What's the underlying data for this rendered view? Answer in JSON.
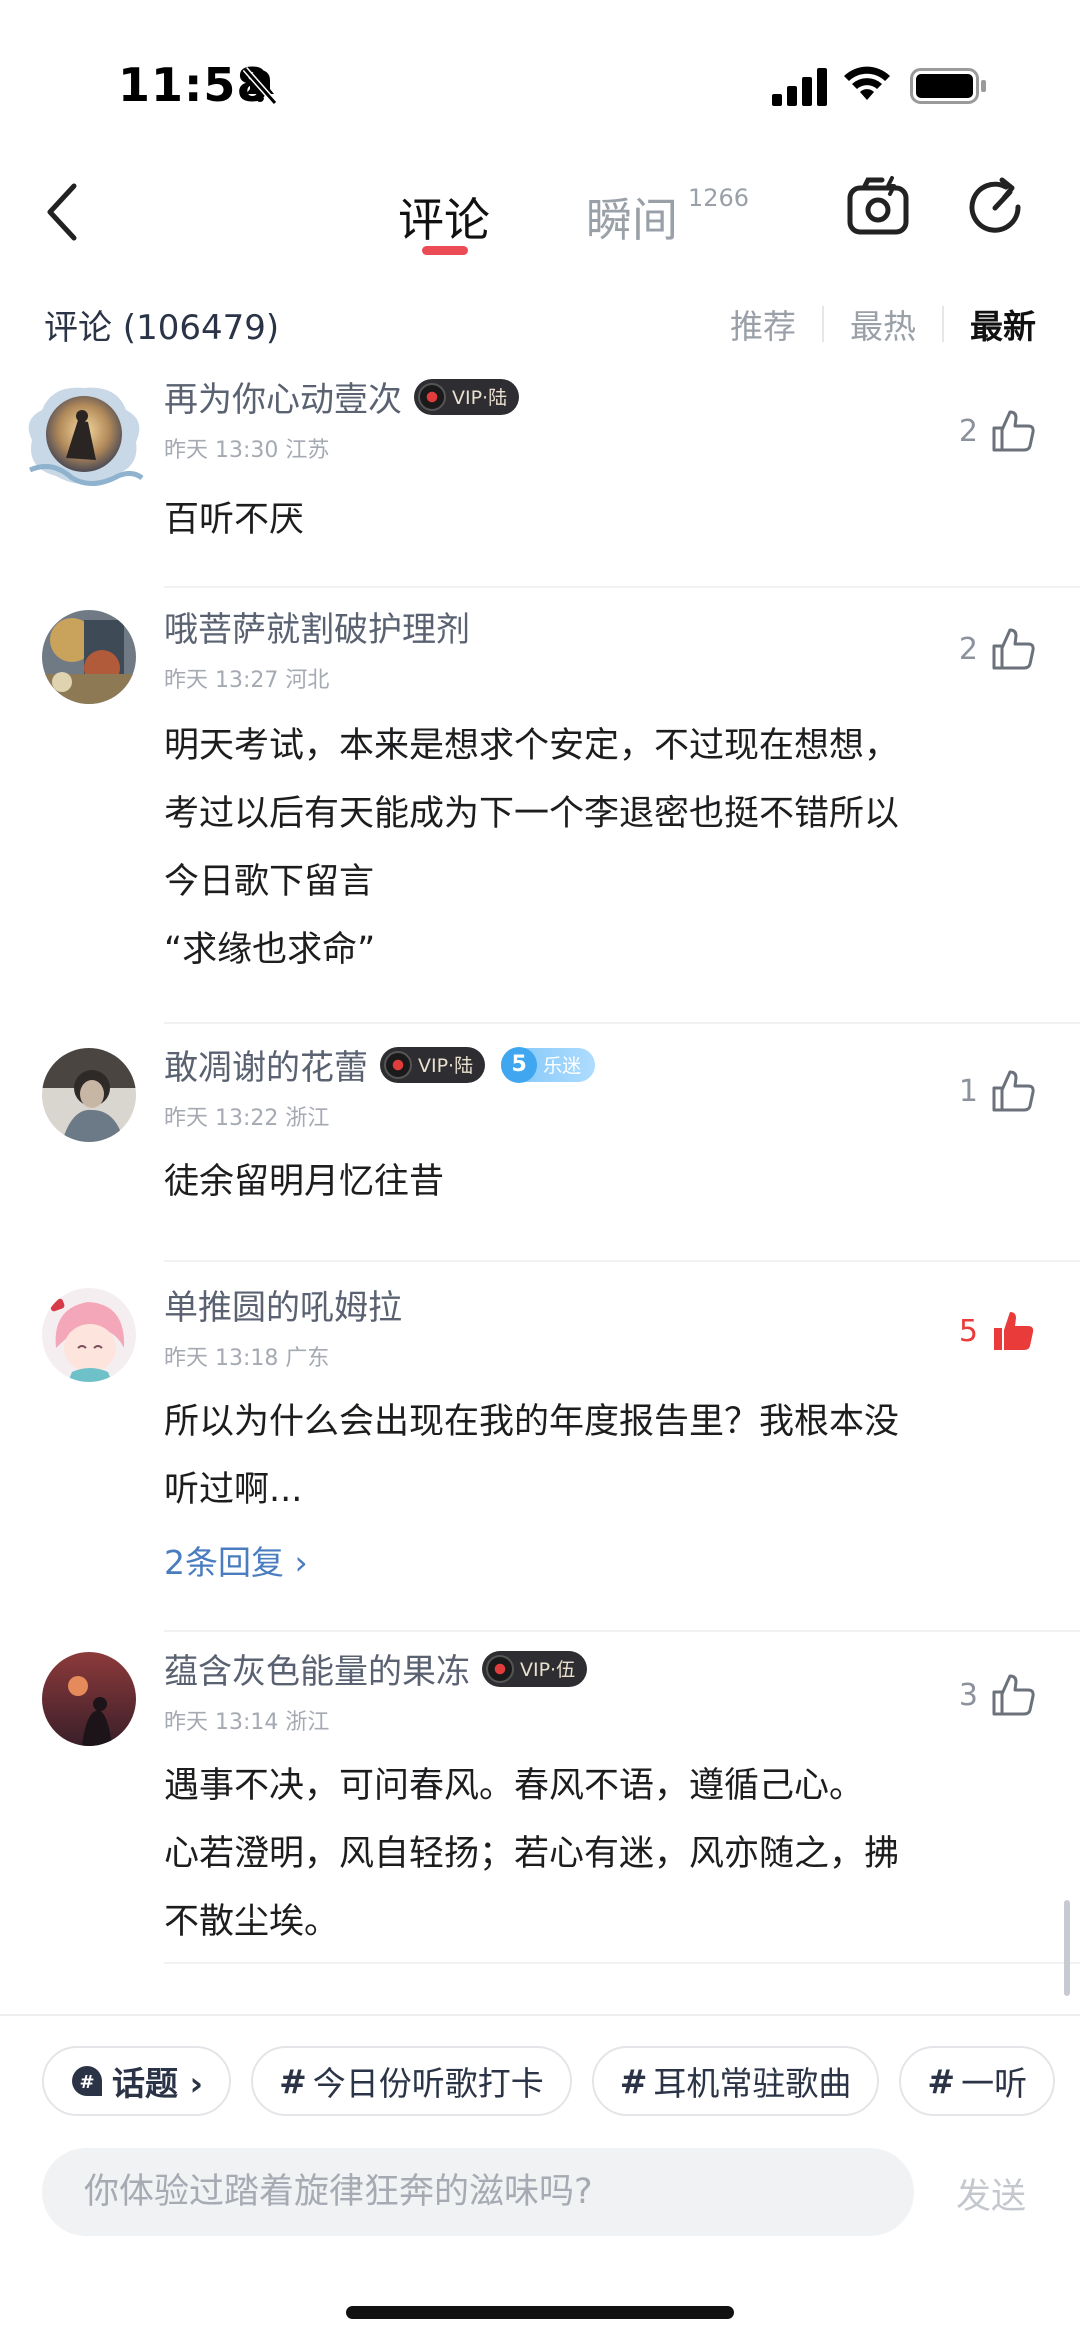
{
  "status": {
    "time": "11:58"
  },
  "nav": {
    "tab_comment": "评论",
    "tab_moment": "瞬间",
    "moment_count": "1266"
  },
  "comment_header": {
    "count_label": "评论 (106479)",
    "sort": [
      "推荐",
      "最热",
      "最新"
    ],
    "active_sort": "最新"
  },
  "comments": [
    {
      "username": "再为你心动壹次",
      "vip": "VIP·陆",
      "meta": "昨天 13:30 江苏",
      "likes": "2",
      "liked": false,
      "body": [
        "百听不厌"
      ]
    },
    {
      "username": "哦菩萨就割破护理剂",
      "meta": "昨天 13:27 河北",
      "likes": "2",
      "liked": false,
      "body": [
        "明天考试，本来是想求个安定，不过现在想想，",
        "考过以后有天能成为下一个李退密也挺不错所以",
        "今日歌下留言",
        "“求缘也求命”"
      ]
    },
    {
      "username": "敢凋谢的花蕾",
      "vip": "VIP·陆",
      "fan_level": "5",
      "fan_label": "乐迷",
      "meta": "昨天 13:22 浙江",
      "likes": "1",
      "liked": false,
      "body": [
        "徒余留明月忆往昔"
      ]
    },
    {
      "username": "单推圆的吼姆拉",
      "meta": "昨天 13:18 广东",
      "likes": "5",
      "liked": true,
      "body": [
        "所以为什么会出现在我的年度报告里？我根本没",
        "听过啊..."
      ],
      "replies": "2条回复 ›"
    },
    {
      "username": "蕴含灰色能量的果冻",
      "vip": "VIP·伍",
      "meta": "昨天 13:14 浙江",
      "likes": "3",
      "liked": false,
      "body": [
        "遇事不决，可问春风。春风不语，遵循己心。",
        "心若澄明，风自轻扬；若心有迷，风亦随之，拂",
        "不散尘埃。"
      ]
    }
  ],
  "topics": {
    "main": "话题 ›",
    "chips": [
      "今日份听歌打卡",
      "耳机常驻歌曲",
      "一听"
    ]
  },
  "input": {
    "placeholder": "你体验过踏着旋律狂奔的滋味吗?",
    "send": "发送"
  },
  "colors": {
    "accent": "#ea4b54",
    "like_red": "#ea3b3b",
    "link_blue": "#4a7cc0"
  }
}
